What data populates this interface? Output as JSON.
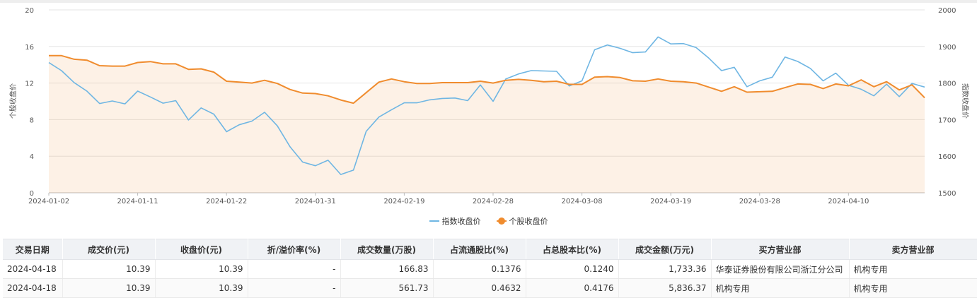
{
  "chart_data": {
    "type": "line",
    "x_ticks": [
      "2024-01-02",
      "2024-01-11",
      "2024-01-22",
      "2024-01-31",
      "2024-02-19",
      "2024-02-28",
      "2024-03-08",
      "2024-03-19",
      "2024-03-28",
      "2024-04-10"
    ],
    "x_tick_index": [
      0,
      7,
      14,
      21,
      28,
      35,
      42,
      49,
      56,
      63
    ],
    "y_left": {
      "label": "个股收盘价",
      "min": 0,
      "max": 20,
      "ticks": [
        "0",
        "4",
        "8",
        "12",
        "16",
        "20"
      ]
    },
    "y_right": {
      "label": "指数收盘价",
      "min": 1500,
      "max": 2000,
      "ticks": [
        "1500",
        "1600",
        "1700",
        "1800",
        "1900",
        "2000"
      ]
    },
    "grid": true,
    "legend_position": "bottom",
    "series": [
      {
        "name": "指数收盘价",
        "axis": "right",
        "color": "#6fb6e3",
        "area": false,
        "values": [
          1856,
          1834,
          1801,
          1778,
          1744,
          1751,
          1743,
          1778,
          1762,
          1745,
          1752,
          1699,
          1732,
          1715,
          1667,
          1686,
          1696,
          1720,
          1683,
          1626,
          1584,
          1574,
          1589,
          1550,
          1562,
          1668,
          1707,
          1727,
          1746,
          1746,
          1754,
          1758,
          1759,
          1752,
          1795,
          1750,
          1811,
          1825,
          1834,
          1833,
          1832,
          1792,
          1806,
          1891,
          1904,
          1895,
          1883,
          1885,
          1926,
          1907,
          1908,
          1897,
          1868,
          1834,
          1843,
          1790,
          1806,
          1816,
          1871,
          1859,
          1840,
          1806,
          1827,
          1794,
          1783,
          1765,
          1797,
          1763,
          1799,
          1789
        ]
      },
      {
        "name": "个股收盘价",
        "axis": "left",
        "color": "#f08c2e",
        "area": true,
        "values": [
          15.0,
          15.0,
          14.6,
          14.5,
          13.9,
          13.85,
          13.85,
          14.25,
          14.35,
          14.1,
          14.1,
          13.5,
          13.55,
          13.2,
          12.2,
          12.1,
          12.0,
          12.3,
          11.95,
          11.3,
          10.9,
          10.85,
          10.6,
          10.15,
          9.8,
          10.95,
          12.1,
          12.45,
          12.15,
          11.95,
          11.95,
          12.05,
          12.05,
          12.05,
          12.2,
          12.0,
          12.3,
          12.4,
          12.3,
          12.15,
          12.2,
          11.85,
          11.85,
          12.65,
          12.7,
          12.6,
          12.25,
          12.2,
          12.45,
          12.2,
          12.15,
          12.0,
          11.55,
          11.1,
          11.6,
          11.0,
          11.05,
          11.1,
          11.5,
          11.9,
          11.85,
          11.4,
          11.9,
          11.7,
          12.35,
          11.6,
          12.15,
          11.25,
          11.8,
          10.39
        ]
      }
    ]
  },
  "table": {
    "headers": [
      "交易日期",
      "成交价(元)",
      "收盘价(元)",
      "折/溢价率(%)",
      "成交数量(万股)",
      "占流通股比(%)",
      "占总股本比(%)",
      "成交金额(万元)",
      "买方营业部",
      "卖方营业部"
    ],
    "rows": [
      [
        "2024-04-18",
        "10.39",
        "10.39",
        "-",
        "166.83",
        "0.1376",
        "0.1240",
        "1,733.36",
        "华泰证券股份有限公司浙江分公司",
        "机构专用"
      ],
      [
        "2024-04-18",
        "10.39",
        "10.39",
        "-",
        "561.73",
        "0.4632",
        "0.4176",
        "5,836.37",
        "机构专用",
        "机构专用"
      ]
    ]
  }
}
